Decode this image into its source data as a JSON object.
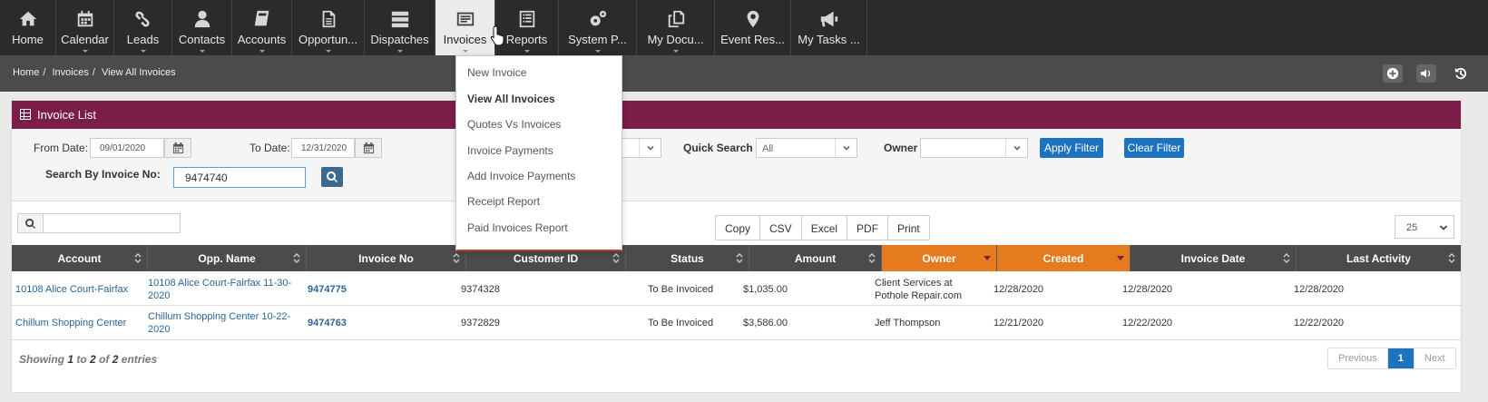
{
  "nav": [
    {
      "label": "Home",
      "icon": "home-icon"
    },
    {
      "label": "Calendar",
      "icon": "calendar-icon"
    },
    {
      "label": "Leads",
      "icon": "link-icon"
    },
    {
      "label": "Contacts",
      "icon": "user-icon"
    },
    {
      "label": "Accounts",
      "icon": "book-icon"
    },
    {
      "label": "Opportun...",
      "icon": "document-icon"
    },
    {
      "label": "Dispatches",
      "icon": "server-icon"
    },
    {
      "label": "Invoices",
      "icon": "invoice-icon"
    },
    {
      "label": "Reports",
      "icon": "report-icon"
    },
    {
      "label": "System P...",
      "icon": "gears-icon"
    },
    {
      "label": "My Docu...",
      "icon": "files-icon"
    },
    {
      "label": "Event Res...",
      "icon": "map-marker-icon"
    },
    {
      "label": "My Tasks ...",
      "icon": "megaphone-icon"
    }
  ],
  "breadcrumb": [
    "Home",
    "Invoices",
    "View All Invoices"
  ],
  "panel": {
    "title": "Invoice List"
  },
  "filters": {
    "from_label": "From Date:",
    "from_value": "09/01/2020",
    "to_label": "To Date:",
    "to_value": "12/31/2020",
    "quick_search_label": "Quick Search",
    "quick_search_value": "All",
    "owner_label": "Owner",
    "owner_value": "",
    "apply_label": "Apply Filter",
    "clear_label": "Clear Filter",
    "invoice_no_label": "Search By Invoice No:",
    "invoice_no_value": "9474740"
  },
  "toolbar": {
    "export_buttons": [
      "Copy",
      "CSV",
      "Excel",
      "PDF",
      "Print"
    ],
    "page_size": "25"
  },
  "table": {
    "columns": [
      "Account",
      "Opp. Name",
      "Invoice No",
      "Customer ID",
      "Status",
      "Amount",
      "Owner",
      "Created",
      "Invoice Date",
      "Last Activity"
    ],
    "rows": [
      {
        "account": "10108 Alice Court-Fairfax",
        "opp_name_1": "10108 Alice Court-Fairfax 11-30-",
        "opp_name_2": "2020",
        "invoice_no": "9474775",
        "customer_id": "9374328",
        "status": "To Be Invoiced",
        "amount": "$1,035.00",
        "owner_1": "Client Services at",
        "owner_2": "Pothole Repair.com",
        "created": "12/28/2020",
        "invoice_date": "12/28/2020",
        "last_activity": "12/28/2020"
      },
      {
        "account": "Chillum Shopping Center",
        "opp_name_1": "Chillum Shopping Center 10-22-",
        "opp_name_2": "2020",
        "invoice_no": "9474763",
        "customer_id": "9372829",
        "status": "To Be Invoiced",
        "amount": "$3,586.00",
        "owner_1": "Jeff Thompson",
        "owner_2": "",
        "created": "12/21/2020",
        "invoice_date": "12/22/2020",
        "last_activity": "12/22/2020"
      }
    ]
  },
  "footer": {
    "showing": "Showing",
    "from": "1",
    "to_word": "to",
    "to": "2",
    "of_word": "of",
    "total": "2",
    "entries": "entries",
    "prev": "Previous",
    "page": "1",
    "next": "Next"
  },
  "dropdown": {
    "items": [
      "New Invoice",
      "View All Invoices",
      "Quotes Vs Invoices",
      "Invoice Payments",
      "Add Invoice Payments",
      "Receipt Report",
      "Paid Invoices Report"
    ]
  },
  "colors": {
    "header": "#7a1d48",
    "accent": "#1e73be",
    "sorted_col": "#e67a1f",
    "nav": "#2b2b2b"
  }
}
